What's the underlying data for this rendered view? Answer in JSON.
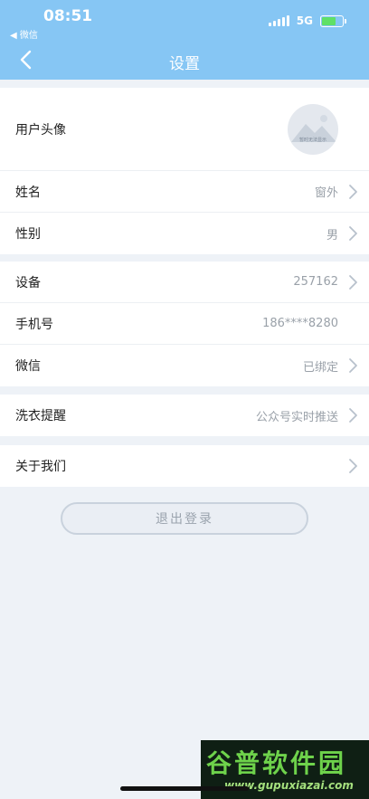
{
  "status_bar": {
    "time": "08:51",
    "back_app": "◀ 微信",
    "network": "5G"
  },
  "nav": {
    "title": "设置"
  },
  "profile": {
    "avatar_label": "用户头像",
    "avatar_caption": "暂时无法显示",
    "name_label": "姓名",
    "name_value": "窗外",
    "gender_label": "性别",
    "gender_value": "男"
  },
  "account": {
    "device_label": "设备",
    "device_value": "257162",
    "phone_label": "手机号",
    "phone_value": "186****8280",
    "wechat_label": "微信",
    "wechat_value": "已绑定"
  },
  "notify": {
    "label": "洗衣提醒",
    "value": "公众号实时推送"
  },
  "about": {
    "label": "关于我们"
  },
  "logout_label": "退出登录",
  "watermark": {
    "main": "谷普软件园",
    "sub": "www.gupuxiazai.com"
  },
  "colors": {
    "header": "#86c6f4",
    "background": "#eef2f7",
    "accent_battery": "#5fe067"
  }
}
